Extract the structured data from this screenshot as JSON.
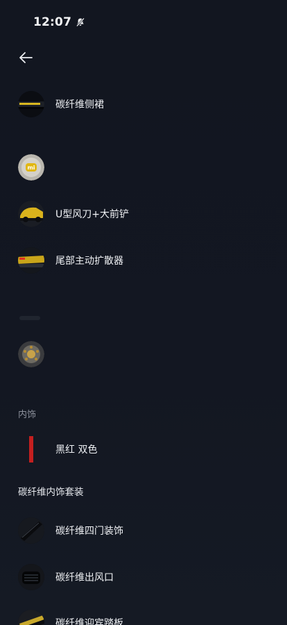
{
  "status_bar": {
    "time": "12:07",
    "silent_icon": "bell-slash-icon"
  },
  "nav": {
    "back_icon": "arrow-left-icon"
  },
  "items": [
    {
      "label": "碳纤维侧裙",
      "icon": "side-skirt-thumbnail"
    },
    {
      "label": "",
      "icon": "mi-wheel-hub-thumbnail"
    },
    {
      "label": "U型风刀+大前铲",
      "icon": "front-splitter-thumbnail"
    },
    {
      "label": "尾部主动扩散器",
      "icon": "rear-diffuser-thumbnail"
    },
    {
      "label": "",
      "icon": "brake-caliper-thumbnail"
    }
  ],
  "interior": {
    "section_title": "内饰",
    "color_option": {
      "label": "黑红 双色",
      "icon": "red-accent-swatch"
    }
  },
  "carbon_interior": {
    "section_title": "碳纤维内饰套装",
    "items": [
      {
        "label": "碳纤维四门装饰",
        "icon": "door-trim-thumbnail"
      },
      {
        "label": "碳纤维出风口",
        "icon": "air-vent-thumbnail"
      },
      {
        "label": "碳纤维迎宾踏板",
        "icon": "sill-plate-thumbnail"
      }
    ]
  },
  "colors": {
    "background": "#131722",
    "text": "#f0f2f5",
    "muted": "#8c919c",
    "accent_yellow": "#e8c21b",
    "accent_red": "#c41f1f"
  }
}
